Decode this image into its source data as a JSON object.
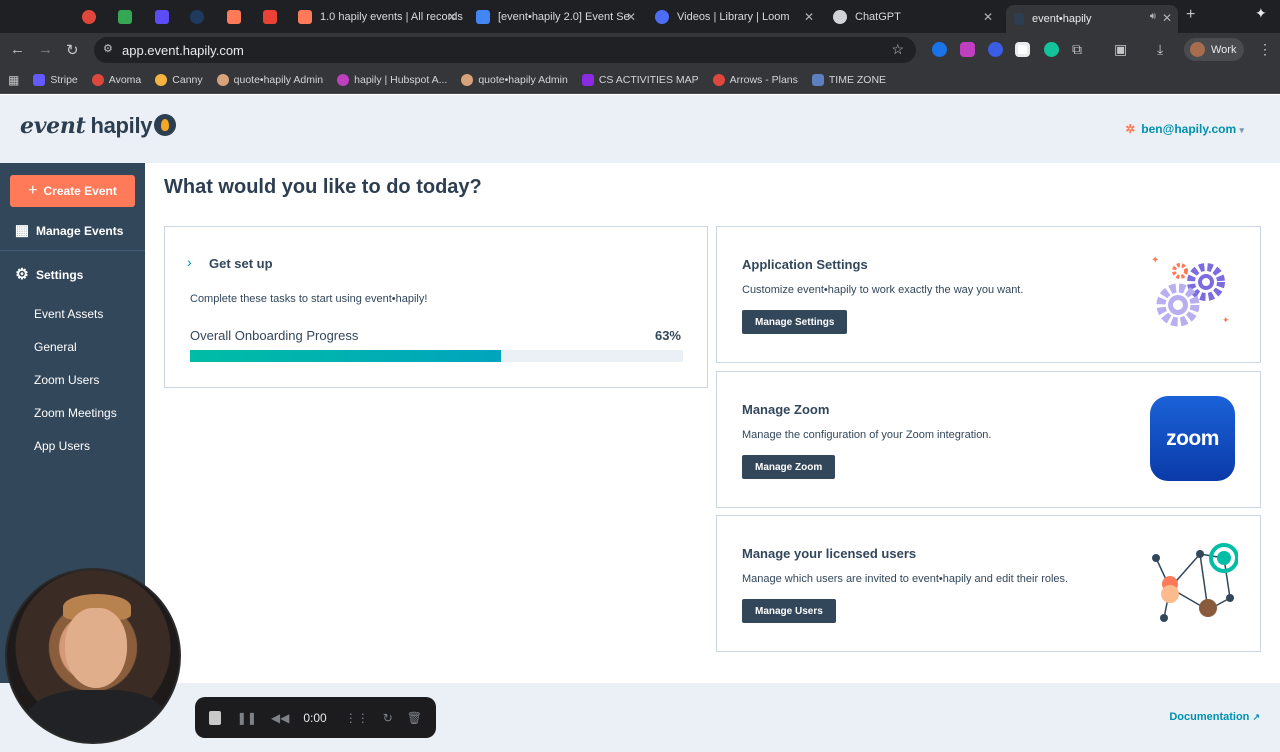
{
  "browser": {
    "tabs": [
      {
        "label": "",
        "color": "#e0473c"
      },
      {
        "label": "",
        "color": "#34a853"
      },
      {
        "label": "",
        "color": "#5b4cf5"
      },
      {
        "label": "",
        "color": "#1e3a5f"
      },
      {
        "label": "",
        "color": "#ff7a59"
      },
      {
        "label": "",
        "color": "#ea4335"
      },
      {
        "label": "1.0 hapily events | All records",
        "color": "#ff7a59"
      },
      {
        "label": "[event•hapily 2.0] Event Se",
        "color": "#4285f4"
      },
      {
        "label": "Videos | Library | Loom",
        "color": "#4c6ef5"
      },
      {
        "label": "ChatGPT",
        "color": "#cfd2d6"
      },
      {
        "label": "event•hapily",
        "color": "#2d3e50"
      }
    ],
    "url": "app.event.hapily.com",
    "profile_label": "Work",
    "bookmarks": [
      {
        "label": "Stripe",
        "color": "#635bff"
      },
      {
        "label": "Avoma",
        "color": "#e0473c"
      },
      {
        "label": "Canny",
        "color": "#f5b342"
      },
      {
        "label": "quote•hapily Admin",
        "color": "#d8a27a"
      },
      {
        "label": "hapily | Hubspot A...",
        "color": "#c03fbf"
      },
      {
        "label": "quote•hapily Admin",
        "color": "#d8a27a"
      },
      {
        "label": "CS ACTIVITIES MAP",
        "color": "#8a2be2"
      },
      {
        "label": "Arrows - Plans",
        "color": "#e0473c"
      },
      {
        "label": "TIME ZONE",
        "color": "#5b7fbf"
      }
    ]
  },
  "app": {
    "logo_word1": "event",
    "logo_word2": "hapily",
    "user_email": "ben@hapily.com",
    "user_caret": "▾"
  },
  "sidebar": {
    "create_label": "Create Event",
    "manage_events_label": "Manage Events",
    "settings_label": "Settings",
    "sub_items": [
      "Event Assets",
      "General",
      "Zoom Users",
      "Zoom Meetings",
      "App Users"
    ]
  },
  "main": {
    "title": "What would you like to do today?",
    "setup": {
      "title": "Get set up",
      "description": "Complete these tasks to start using event•hapily!",
      "progress_label": "Overall Onboarding Progress",
      "progress_text": "63%",
      "progress_value": 0.63
    },
    "actions": [
      {
        "title": "Application Settings",
        "description": "Customize event•hapily to work exactly the way you want.",
        "button": "Manage Settings",
        "art": "gears-icon"
      },
      {
        "title": "Manage Zoom",
        "description": "Manage the configuration of your Zoom integration.",
        "button": "Manage Zoom",
        "art": "zoom"
      },
      {
        "title": "Manage your licensed users",
        "description": "Manage which users are invited to event•hapily and edit their roles.",
        "button": "Manage Users",
        "art": "user-network-icon"
      }
    ]
  },
  "footer": {
    "documentation_label": "Documentation",
    "external_icon": "↗"
  },
  "recorder": {
    "time": "0:00"
  }
}
